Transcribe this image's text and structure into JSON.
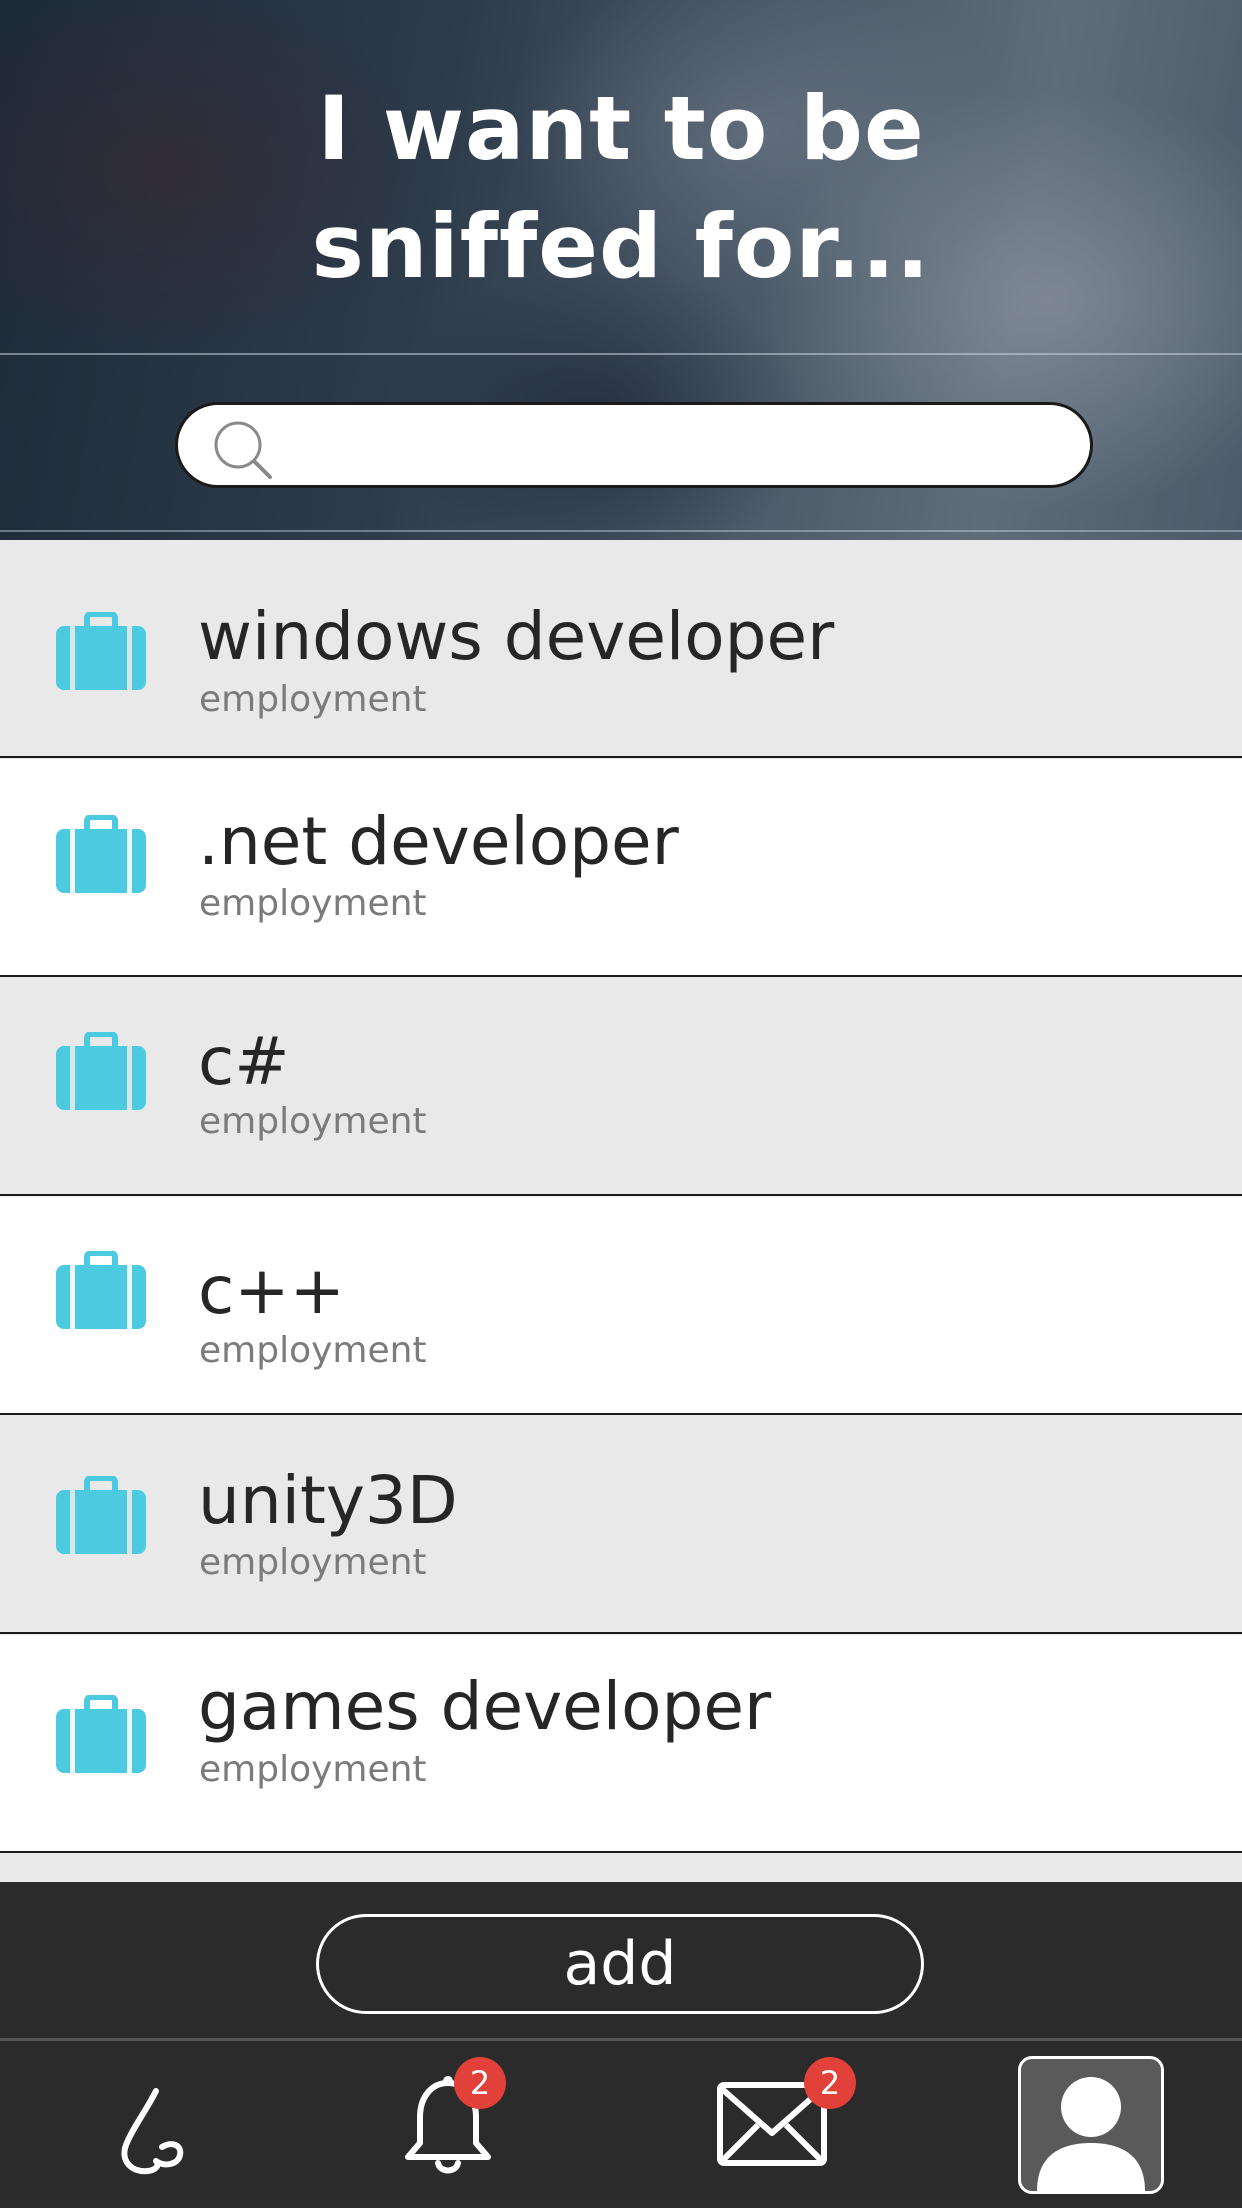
{
  "header": {
    "title_line1": "I want to be",
    "title_line2": "sniffed for..."
  },
  "search": {
    "icon": "search-icon",
    "value": "",
    "placeholder": ""
  },
  "list": {
    "icon": "briefcase-icon",
    "icon_color": "#4ccbe0",
    "items": [
      {
        "title": "windows developer",
        "category": "employment"
      },
      {
        "title": ".net developer",
        "category": "employment"
      },
      {
        "title": "c#",
        "category": "employment"
      },
      {
        "title": "c++",
        "category": "employment"
      },
      {
        "title": "unity3D",
        "category": "employment"
      },
      {
        "title": "games developer",
        "category": "employment"
      }
    ]
  },
  "add_bar": {
    "add_label": "add"
  },
  "tab_bar": {
    "tabs": [
      {
        "name": "sniff",
        "icon": "nose-icon"
      },
      {
        "name": "notifications",
        "icon": "bell-icon",
        "badge": "2"
      },
      {
        "name": "messages",
        "icon": "envelope-icon",
        "badge": "2"
      },
      {
        "name": "profile",
        "icon": "profile-icon",
        "selected": true
      }
    ],
    "badge_color": "#e2413a"
  }
}
